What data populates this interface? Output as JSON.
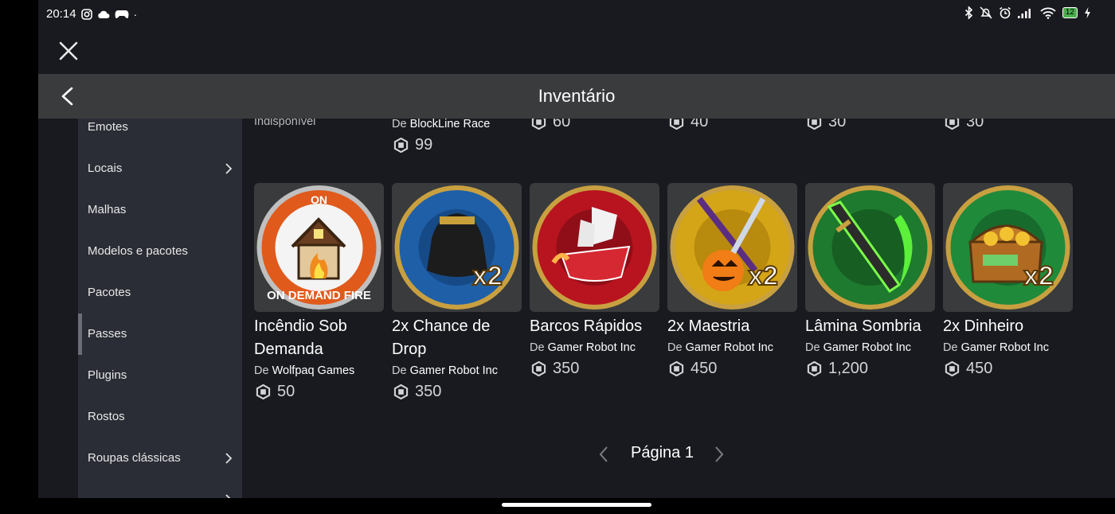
{
  "status": {
    "time": "20:14",
    "battery": "12"
  },
  "header": {
    "title": "Inventário"
  },
  "sidebar": {
    "items": [
      {
        "label": "Emotes"
      },
      {
        "label": "Locais"
      },
      {
        "label": "Malhas"
      },
      {
        "label": "Modelos e pacotes"
      },
      {
        "label": "Pacotes"
      },
      {
        "label": "Passes"
      },
      {
        "label": "Plugins"
      },
      {
        "label": "Rostos"
      },
      {
        "label": "Roupas clássicas"
      }
    ]
  },
  "top_row": [
    {
      "status": "Indisponível"
    },
    {
      "by_prefix": "De",
      "creator": "BlockLine Race",
      "price": "99"
    },
    {
      "price": "60"
    },
    {
      "price": "40"
    },
    {
      "price": "30"
    },
    {
      "price": "30"
    }
  ],
  "items": [
    {
      "name": "Incêndio Sob Demanda",
      "by_prefix": "De",
      "creator": "Wolfpaq Games",
      "price": "50",
      "badge": "ON DEMAND FIRE"
    },
    {
      "name": "2x Chance de Drop",
      "by_prefix": "De",
      "creator": "Gamer Robot Inc",
      "price": "350",
      "badge": "x2"
    },
    {
      "name": "Barcos Rápidos",
      "by_prefix": "De",
      "creator": "Gamer Robot Inc",
      "price": "350"
    },
    {
      "name": "2x Maestria",
      "by_prefix": "De",
      "creator": "Gamer Robot Inc",
      "price": "450",
      "badge": "x2"
    },
    {
      "name": "Lâmina Sombria",
      "by_prefix": "De",
      "creator": "Gamer Robot Inc",
      "price": "1,200"
    },
    {
      "name": "2x Dinheiro",
      "by_prefix": "De",
      "creator": "Gamer Robot Inc",
      "price": "450",
      "badge": "x2"
    }
  ],
  "pager": {
    "label": "Página 1"
  },
  "icons": {
    "close": "close-icon",
    "back": "back-arrow-icon",
    "currency": "robux-icon",
    "chevron": "chevron-right-icon",
    "prev": "chevron-left-icon",
    "next": "chevron-right-icon"
  },
  "colors": {
    "background": "#191a1f",
    "header": "#393b3d",
    "sidebar": "#2b2d36",
    "card": "#393b3d"
  }
}
